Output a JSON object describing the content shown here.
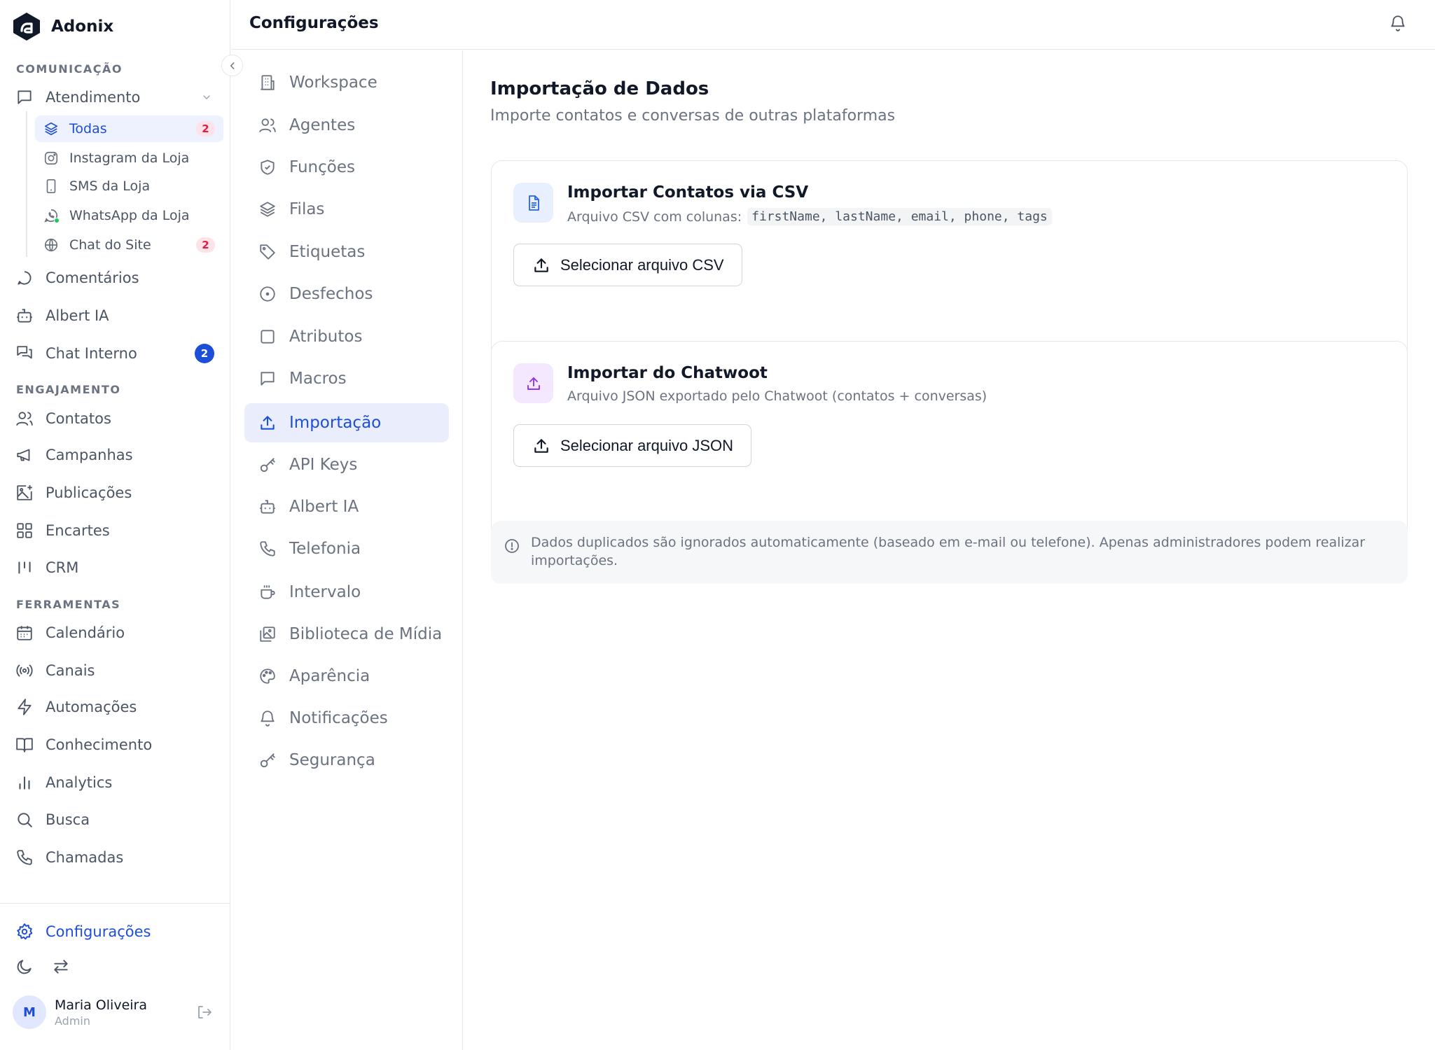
{
  "brand": {
    "name": "Adonix"
  },
  "sidebar": {
    "sections": {
      "comunicacao": "COMUNICAÇÃO",
      "engajamento": "ENGAJAMENTO",
      "ferramentas": "FERRAMENTAS"
    },
    "atendimento": {
      "label": "Atendimento",
      "children": [
        {
          "label": "Todas",
          "badge": "2",
          "icon": "layers-icon",
          "active": true
        },
        {
          "label": "Instagram da Loja",
          "icon": "instagram-icon"
        },
        {
          "label": "SMS da Loja",
          "icon": "smartphone-icon"
        },
        {
          "label": "WhatsApp da Loja",
          "icon": "whatsapp-icon"
        },
        {
          "label": "Chat do Site",
          "badge": "2",
          "icon": "globe-icon"
        }
      ]
    },
    "items": {
      "comentarios": "Comentários",
      "albert_ia": "Albert IA",
      "chat_interno": {
        "label": "Chat Interno",
        "badge": "2"
      },
      "contatos": "Contatos",
      "campanhas": "Campanhas",
      "publicacoes": "Publicações",
      "encartes": "Encartes",
      "crm": "CRM",
      "calendario": "Calendário",
      "canais": "Canais",
      "automacoes": "Automações",
      "conhecimento": "Conhecimento",
      "analytics": "Analytics",
      "busca": "Busca",
      "chamadas": "Chamadas"
    },
    "configuracoes": "Configurações",
    "user": {
      "initial": "M",
      "name": "Maria Oliveira",
      "role": "Admin"
    }
  },
  "header": {
    "title": "Configurações"
  },
  "settings_nav": [
    {
      "label": "Workspace",
      "icon": "building-icon"
    },
    {
      "label": "Agentes",
      "icon": "users-icon"
    },
    {
      "label": "Funções",
      "icon": "shield-icon"
    },
    {
      "label": "Filas",
      "icon": "layers-icon"
    },
    {
      "label": "Etiquetas",
      "icon": "tag-icon"
    },
    {
      "label": "Desfechos",
      "icon": "circle-dot-icon"
    },
    {
      "label": "Atributos",
      "icon": "square-icon"
    },
    {
      "label": "Macros",
      "icon": "message-square-icon"
    },
    {
      "label": "Importação",
      "icon": "upload-icon",
      "active": true
    },
    {
      "label": "API Keys",
      "icon": "key-icon"
    },
    {
      "label": "Albert IA",
      "icon": "bot-icon"
    },
    {
      "label": "Telefonia",
      "icon": "phone-icon"
    },
    {
      "label": "Intervalo",
      "icon": "coffee-icon"
    },
    {
      "label": "Biblioteca de Mídia",
      "icon": "images-icon"
    },
    {
      "label": "Aparência",
      "icon": "palette-icon"
    },
    {
      "label": "Notificações",
      "icon": "bell-icon"
    },
    {
      "label": "Segurança",
      "icon": "key-icon"
    }
  ],
  "main": {
    "title": "Importação de Dados",
    "subtitle": "Importe contatos e conversas de outras plataformas",
    "csv_card": {
      "title": "Importar Contatos via CSV",
      "desc": "Arquivo CSV com colunas:",
      "columns": "firstName, lastName, email, phone, tags",
      "button": "Selecionar arquivo CSV"
    },
    "chatwoot_card": {
      "title": "Importar do Chatwoot",
      "desc": "Arquivo JSON exportado pelo Chatwoot (contatos + conversas)",
      "button": "Selecionar arquivo JSON"
    },
    "notice": "Dados duplicados são ignorados automaticamente (baseado em e-mail ou telefone). Apenas administradores podem realizar importações."
  },
  "colors": {
    "accent": "#1d4ed8",
    "active_bg": "#e9edfc",
    "badge_red_bg": "#fde2e7",
    "badge_red_text": "#e11d48",
    "csv_icon_bg": "#e8efff",
    "chatwoot_icon_bg": "#f3e8ff"
  }
}
